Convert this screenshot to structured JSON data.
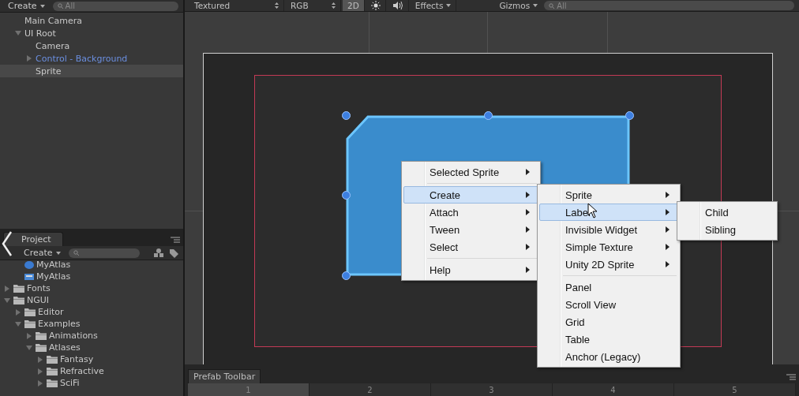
{
  "hierarchy": {
    "create": "Create",
    "search": "All",
    "items": [
      {
        "label": "Main Camera",
        "selected": false,
        "prefab": false,
        "expanded": false
      },
      {
        "label": "UI Root",
        "selected": false,
        "prefab": false,
        "expanded": true,
        "children": [
          {
            "label": "Camera",
            "selected": false,
            "prefab": false,
            "expanded": false
          },
          {
            "label": "Control - Background",
            "selected": false,
            "prefab": true,
            "expanded": false,
            "collapsed_arrow": true
          },
          {
            "label": "Sprite",
            "selected": true,
            "prefab": false,
            "expanded": false
          }
        ]
      }
    ]
  },
  "project": {
    "tab": "Project",
    "create": "Create",
    "items": [
      {
        "label": "MyAtlas",
        "kind": "asset"
      },
      {
        "label": "MyAtlas",
        "kind": "atlas"
      },
      {
        "label": "Fonts",
        "kind": "folder",
        "expanded": false
      },
      {
        "label": "NGUI",
        "kind": "folder",
        "expanded": true,
        "children": [
          {
            "label": "Editor",
            "kind": "folder",
            "expanded": false
          },
          {
            "label": "Examples",
            "kind": "folder",
            "expanded": true,
            "children": [
              {
                "label": "Animations",
                "kind": "folder",
                "expanded": false
              },
              {
                "label": "Atlases",
                "kind": "folder",
                "expanded": true,
                "children": [
                  {
                    "label": "Fantasy",
                    "kind": "folder",
                    "expanded": false
                  },
                  {
                    "label": "Refractive",
                    "kind": "folder",
                    "expanded": false
                  },
                  {
                    "label": "SciFi",
                    "kind": "folder",
                    "expanded": false
                  }
                ]
              }
            ]
          }
        ]
      }
    ]
  },
  "scene_toolbar": {
    "shading": "Textured",
    "channel": "RGB",
    "mode_2d": {
      "label": "2D",
      "on": true
    },
    "effects": "Effects",
    "gizmos": "Gizmos",
    "search": "All"
  },
  "menus": [
    {
      "items": [
        {
          "kind": "item",
          "label": "Selected Sprite",
          "submenu": true,
          "selected": false
        },
        {
          "kind": "separator"
        },
        {
          "kind": "item",
          "label": "Create",
          "submenu": true,
          "selected": true
        },
        {
          "kind": "item",
          "label": "Attach",
          "submenu": true,
          "selected": false
        },
        {
          "kind": "item",
          "label": "Tween",
          "submenu": true,
          "selected": false
        },
        {
          "kind": "item",
          "label": "Select",
          "submenu": true,
          "selected": false
        },
        {
          "kind": "separator"
        },
        {
          "kind": "item",
          "label": "Help",
          "submenu": true,
          "selected": false
        }
      ]
    },
    {
      "items": [
        {
          "kind": "item",
          "label": "Sprite",
          "submenu": true,
          "selected": false
        },
        {
          "kind": "item",
          "label": "Label",
          "submenu": true,
          "selected": true
        },
        {
          "kind": "item",
          "label": "Invisible Widget",
          "submenu": true,
          "selected": false
        },
        {
          "kind": "item",
          "label": "Simple Texture",
          "submenu": true,
          "selected": false
        },
        {
          "kind": "item",
          "label": "Unity 2D Sprite",
          "submenu": true,
          "selected": false
        },
        {
          "kind": "separator"
        },
        {
          "kind": "item",
          "label": "Panel",
          "submenu": false,
          "selected": false
        },
        {
          "kind": "item",
          "label": "Scroll View",
          "submenu": false,
          "selected": false
        },
        {
          "kind": "item",
          "label": "Grid",
          "submenu": false,
          "selected": false
        },
        {
          "kind": "item",
          "label": "Table",
          "submenu": false,
          "selected": false
        },
        {
          "kind": "item",
          "label": "Anchor (Legacy)",
          "submenu": false,
          "selected": false
        }
      ]
    },
    {
      "items": [
        {
          "kind": "item",
          "label": "Child",
          "submenu": false,
          "selected": false
        },
        {
          "kind": "item",
          "label": "Sibling",
          "submenu": false,
          "selected": false
        }
      ]
    }
  ],
  "prefab_toolbar": {
    "title": "Prefab Toolbar",
    "tabs": [
      {
        "label": "1",
        "selected": true
      },
      {
        "label": "2",
        "selected": false
      },
      {
        "label": "3",
        "selected": false
      },
      {
        "label": "4",
        "selected": false
      },
      {
        "label": "5",
        "selected": false
      }
    ]
  }
}
